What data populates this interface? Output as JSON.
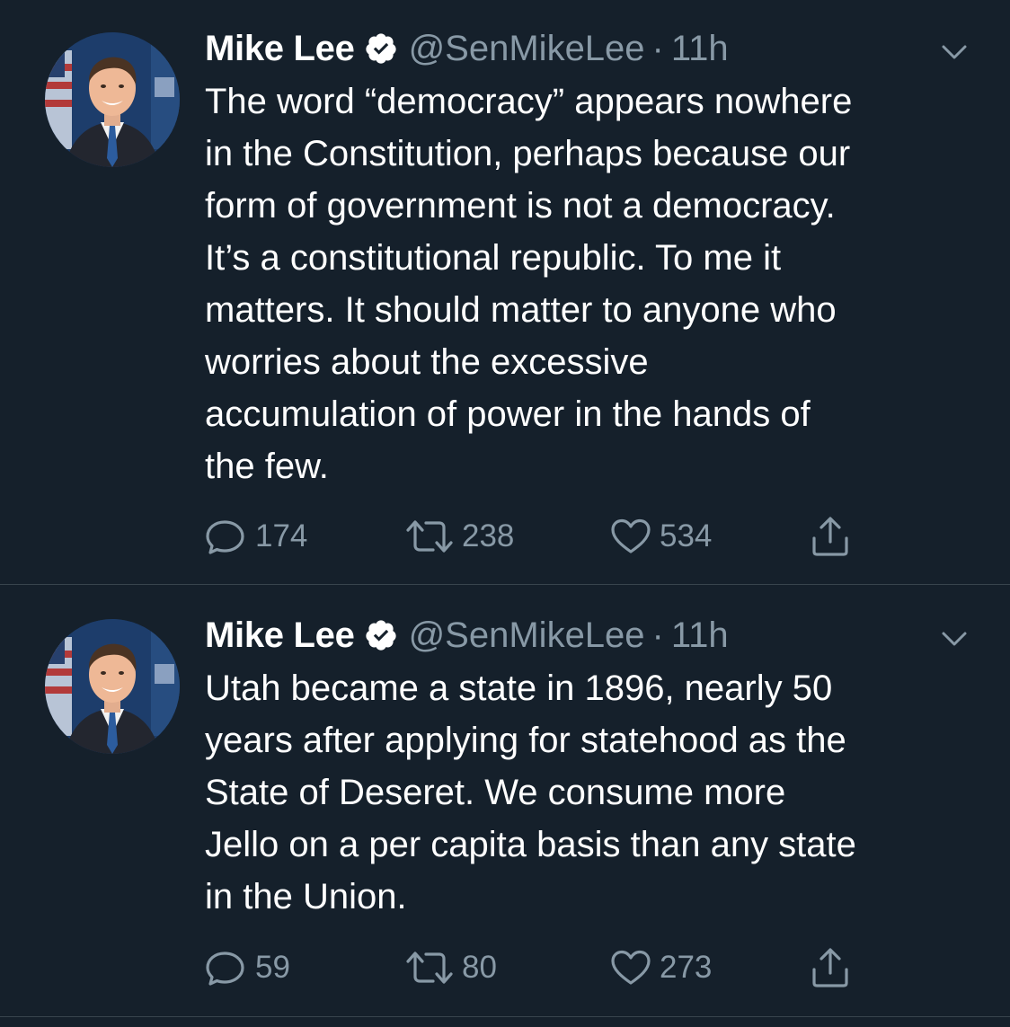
{
  "colors": {
    "background": "#15202b",
    "text": "#ffffff",
    "secondary": "#8899a6",
    "divider": "#38444d",
    "verified_badge": "#ffffff"
  },
  "tweets": [
    {
      "author_name": "Mike Lee",
      "handle": "@SenMikeLee",
      "separator": "·",
      "time": "11h",
      "verified": true,
      "text": "The word “democracy” appears nowhere\nin the Constitution, perhaps because our\nform of government is not a democracy.\nIt’s a constitutional republic.  To me it\nmatters.  It should matter to anyone who\nworries about the excessive\naccumulation of power in the hands of\nthe few.",
      "replies": "174",
      "retweets": "238",
      "likes": "534",
      "icons": [
        "reply-icon",
        "retweet-icon",
        "like-icon",
        "share-icon",
        "chevron-down-icon",
        "verified-badge-icon"
      ]
    },
    {
      "author_name": "Mike Lee",
      "handle": "@SenMikeLee",
      "separator": "·",
      "time": "11h",
      "verified": true,
      "text": "Utah became a state in 1896, nearly 50\nyears after applying for statehood as the\nState of Deseret.  We consume more\nJello on a per capita basis than any state\nin the Union.",
      "replies": "59",
      "retweets": "80",
      "likes": "273",
      "icons": [
        "reply-icon",
        "retweet-icon",
        "like-icon",
        "share-icon",
        "chevron-down-icon",
        "verified-badge-icon"
      ]
    }
  ]
}
